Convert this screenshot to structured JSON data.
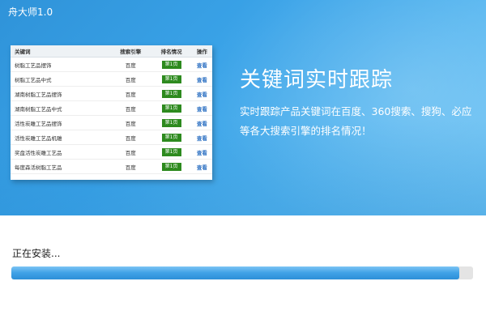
{
  "app": {
    "title": "舟大师1.0"
  },
  "preview_table": {
    "headers": [
      "关键词",
      "搜索引擎",
      "排名情况",
      "操作"
    ],
    "rows": [
      {
        "keyword": "树脂工艺品摆饰",
        "engine": "百度",
        "rank": "第1页",
        "action": "查看"
      },
      {
        "keyword": "树脂工艺品中式",
        "engine": "百度",
        "rank": "第1页",
        "action": "查看"
      },
      {
        "keyword": "湖南树脂工艺品摆饰",
        "engine": "百度",
        "rank": "第1页",
        "action": "查看"
      },
      {
        "keyword": "湖南树脂工艺品中式",
        "engine": "百度",
        "rank": "第1页",
        "action": "查看"
      },
      {
        "keyword": "活性炭雕工艺品摆饰",
        "engine": "百度",
        "rank": "第1页",
        "action": "查看"
      },
      {
        "keyword": "活性炭雕工艺品机雕",
        "engine": "百度",
        "rank": "第1页",
        "action": "查看"
      },
      {
        "keyword": "奖盘活性炭雕工艺品",
        "engine": "百度",
        "rank": "第1页",
        "action": "查看"
      },
      {
        "keyword": "每度森活树脂工艺品",
        "engine": "百度",
        "rank": "第1页",
        "action": "查看"
      }
    ]
  },
  "promo": {
    "headline": "关键词实时跟踪",
    "description": "实时跟踪产品关键词在百度、360搜索、搜狗、必应等各大搜索引擎的排名情况！"
  },
  "install": {
    "status": "正在安装...",
    "progress_fraction": 0.97
  },
  "colors": {
    "banner_blue": "#3aa3e8",
    "progress_blue": "#3fa1e6",
    "rank_green": "#2d8a1e",
    "link_blue": "#2b6fc2"
  }
}
